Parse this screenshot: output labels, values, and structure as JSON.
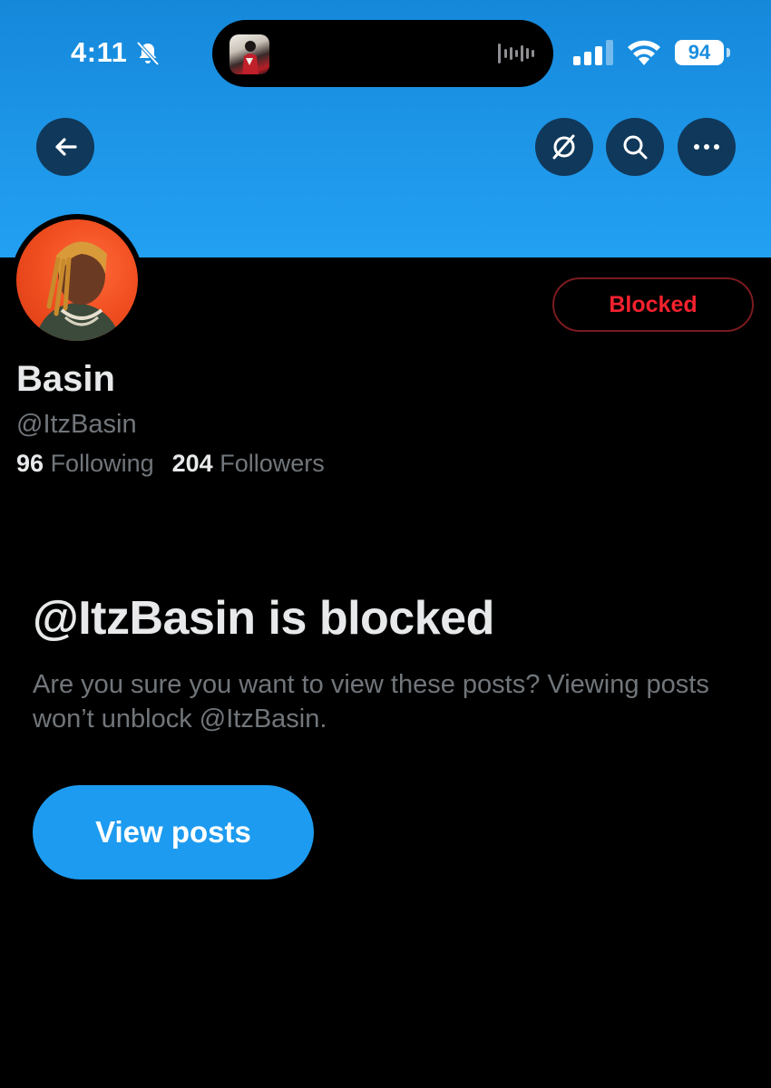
{
  "status_bar": {
    "time": "4:11",
    "battery": "94"
  },
  "nav": {
    "back_icon": "arrow-left-icon",
    "grok_icon": "slashed-circle-icon",
    "search_icon": "search-icon",
    "more_icon": "more-horizontal-icon"
  },
  "profile": {
    "name": "Basin",
    "handle": "@ItzBasin",
    "following_count": "96",
    "following_label": "Following",
    "followers_count": "204",
    "followers_label": "Followers",
    "blocked_label": "Blocked"
  },
  "blocked_notice": {
    "title": "@ItzBasin is blocked",
    "description": "Are you sure you want to view these posts? Viewing posts won’t unblock @ItzBasin.",
    "view_button": "View posts"
  },
  "colors": {
    "banner": "#1e96e8",
    "accent": "#1d9bf0",
    "blocked_red": "#f4212e",
    "background": "#000000"
  }
}
